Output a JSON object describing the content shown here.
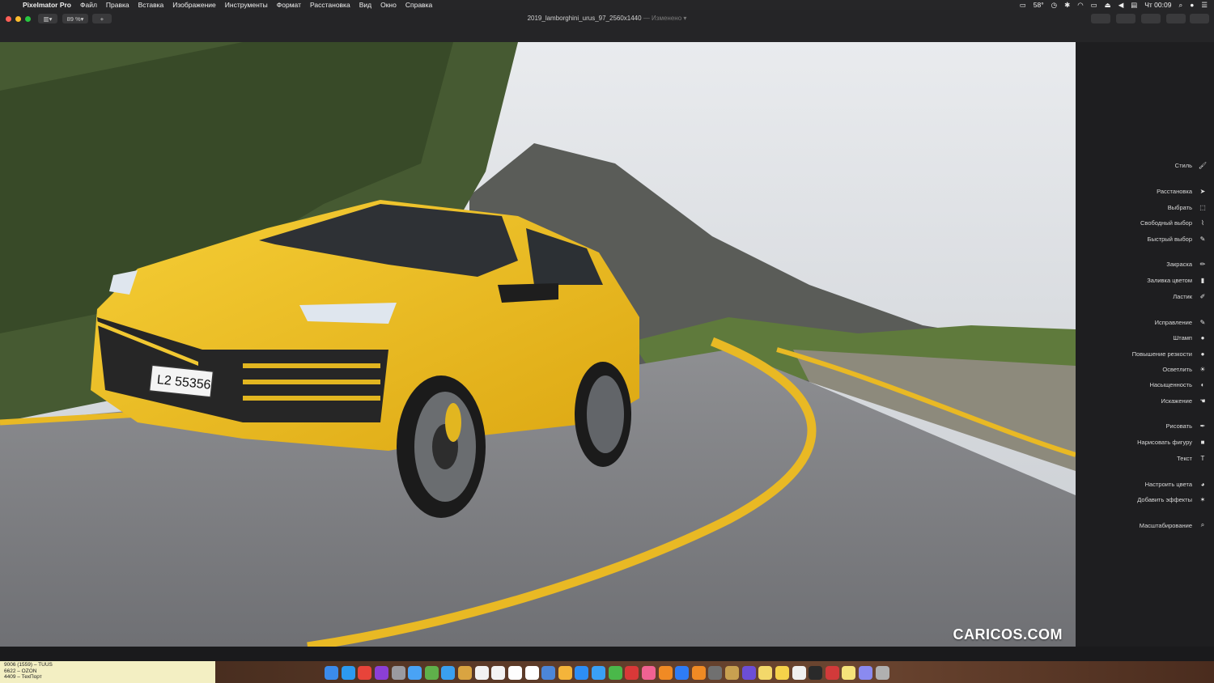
{
  "menubar": {
    "app_name": "Pixelmator Pro",
    "items": [
      "Файл",
      "Правка",
      "Вставка",
      "Изображение",
      "Инструменты",
      "Формат",
      "Расстановка",
      "Вид",
      "Окно",
      "Справка"
    ],
    "temperature": "58°",
    "clock": "Чт 00:09"
  },
  "toolbar": {
    "zoom": "89 %",
    "add_label": "+",
    "doc_title": "2019_lamborghini_urus_97_2560x1440",
    "doc_status": "— Изменено"
  },
  "canvas": {
    "watermark": "CARICOS.COM",
    "plate": "L2 55356"
  },
  "tools": [
    {
      "label": "Стиль",
      "icon": "style-brush-icon",
      "glyph": "🖌"
    },
    {
      "label": "Расстановка",
      "icon": "arrow-pointer-icon",
      "glyph": "➤"
    },
    {
      "label": "Выбрать",
      "icon": "rect-select-icon",
      "glyph": "⬚"
    },
    {
      "label": "Свободный выбор",
      "icon": "lasso-icon",
      "glyph": "⌇"
    },
    {
      "label": "Быстрый выбор",
      "icon": "quick-select-icon",
      "glyph": "✎"
    },
    {
      "label": "Закраска",
      "icon": "paint-brush-icon",
      "glyph": "✏"
    },
    {
      "label": "Заливка цветом",
      "icon": "paint-bucket-icon",
      "glyph": "▮"
    },
    {
      "label": "Ластик",
      "icon": "eraser-icon",
      "glyph": "✐"
    },
    {
      "label": "Исправление",
      "icon": "repair-icon",
      "glyph": "✎"
    },
    {
      "label": "Штамп",
      "icon": "clone-stamp-icon",
      "glyph": "●"
    },
    {
      "label": "Повышение резкости",
      "icon": "sharpen-icon",
      "glyph": "●"
    },
    {
      "label": "Осветлить",
      "icon": "lighten-icon",
      "glyph": "☀"
    },
    {
      "label": "Насыщенность",
      "icon": "saturation-icon",
      "glyph": "◐"
    },
    {
      "label": "Искажение",
      "icon": "distort-icon",
      "glyph": "☚"
    },
    {
      "label": "Рисовать",
      "icon": "pen-icon",
      "glyph": "✒"
    },
    {
      "label": "Нарисовать фигуру",
      "icon": "shape-icon",
      "glyph": "■"
    },
    {
      "label": "Текст",
      "icon": "text-icon",
      "glyph": "T"
    },
    {
      "label": "Настроить цвета",
      "icon": "color-adjust-icon",
      "glyph": "◕"
    },
    {
      "label": "Добавить эффекты",
      "icon": "effects-icon",
      "glyph": "✶"
    },
    {
      "label": "Масштабирование",
      "icon": "zoom-icon",
      "glyph": "⌕"
    }
  ],
  "sticky_note": [
    "9006 (1559) – TUUS",
    "6622 – OZON",
    "4409 – ТехПорт"
  ],
  "dock": {
    "colors": [
      "#3b8beb",
      "#2c9af0",
      "#e8443a",
      "#8b3fd6",
      "#9a9aa0",
      "#49a3f5",
      "#5fb04a",
      "#3aa0f0",
      "#d9a441",
      "#f2f2f2",
      "#f3f3f3",
      "#fefefe",
      "#ffffff",
      "#4c86d8",
      "#f4b43a",
      "#2d8ef5",
      "#3aa0f5",
      "#4ab84a",
      "#d93838",
      "#f06292",
      "#f08a24",
      "#2e7cf6",
      "#f08a24",
      "#707070",
      "#c8a050",
      "#6c4ed6",
      "#f3d86a",
      "#f5d24a",
      "#f0f0f0",
      "#2a2a2a",
      "#d23a3a",
      "#f5e37a",
      "#8a8af0",
      "#b0b0b0"
    ]
  }
}
